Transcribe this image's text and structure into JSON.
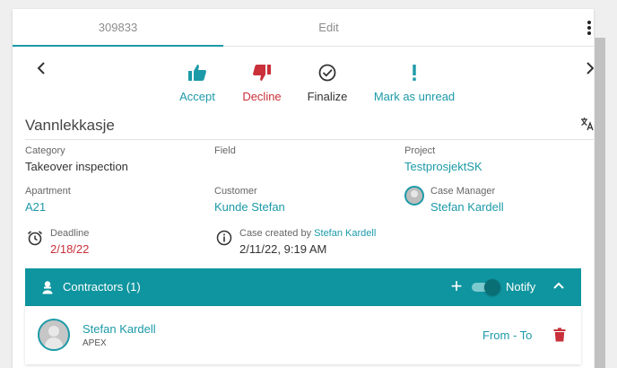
{
  "tabs": [
    {
      "label": "309833"
    },
    {
      "label": "Edit"
    }
  ],
  "actions": {
    "accept": "Accept",
    "decline": "Decline",
    "finalize": "Finalize",
    "mark_unread": "Mark as unread"
  },
  "case": {
    "title": "Vannlekkasje"
  },
  "fields": {
    "category": {
      "label": "Category",
      "value": "Takeover inspection"
    },
    "field": {
      "label": "Field",
      "value": ""
    },
    "project": {
      "label": "Project",
      "value": "TestprosjektSK"
    },
    "apartment": {
      "label": "Apartment",
      "value": "A21"
    },
    "customer": {
      "label": "Customer",
      "value": "Kunde Stefan"
    },
    "case_manager": {
      "label": "Case Manager",
      "value": "Stefan Kardell"
    },
    "deadline": {
      "label": "Deadline",
      "value": "2/18/22"
    },
    "created": {
      "label": "Case created by",
      "by": "Stefan Kardell",
      "value": "2/11/22, 9:19 AM"
    }
  },
  "contractors": {
    "title": "Contractors (1)",
    "plus": "+",
    "notify_label": "Notify",
    "notify_on": true,
    "items": [
      {
        "name": "Stefan Kardell",
        "company": "APEX",
        "period": "From - To"
      }
    ]
  },
  "colors": {
    "accent": "#1c9aa8",
    "danger": "#c9303a",
    "bar": "#0f959f"
  }
}
